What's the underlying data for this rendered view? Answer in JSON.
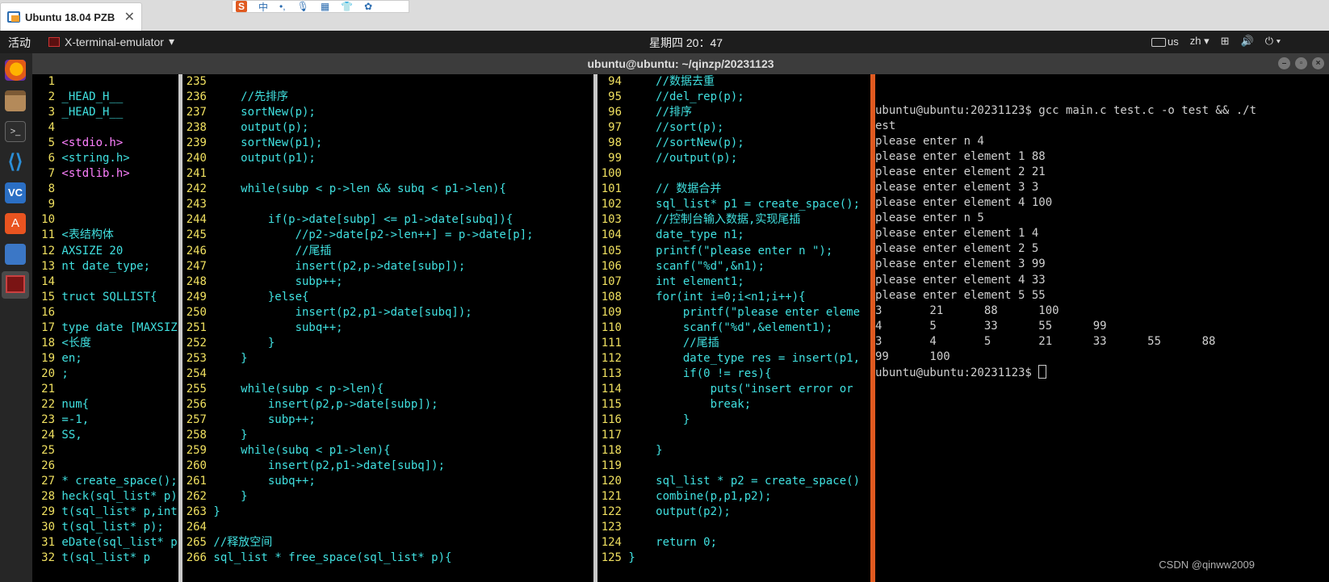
{
  "host": {
    "tab_title": "Ubuntu 18.04 PZB",
    "tab_close": "✕",
    "ime_s": "S",
    "ime_items": [
      "中",
      "•,",
      "🎙",
      "▦",
      "👕",
      "✿"
    ]
  },
  "panel": {
    "activities": "活动",
    "app_menu": "X-terminal-emulator",
    "clock": "星期四 20：47",
    "kbd": "us",
    "lang": "zh",
    "tray_icons": [
      "network-icon",
      "volume-icon",
      "power-icon"
    ]
  },
  "window": {
    "title": "ubuntu@ubuntu: ~/qinzp/20231123"
  },
  "pane1": {
    "rows": [
      {
        "n": "1",
        "t": ""
      },
      {
        "n": "2",
        "t": "_HEAD_H__"
      },
      {
        "n": "3",
        "t": "_HEAD_H__"
      },
      {
        "n": "4",
        "t": ""
      },
      {
        "n": "5",
        "t": "<stdio.h>"
      },
      {
        "n": "6",
        "t": "<string.h>"
      },
      {
        "n": "7",
        "t": "<stdlib.h>"
      },
      {
        "n": "8",
        "t": ""
      },
      {
        "n": "9",
        "t": ""
      },
      {
        "n": "10",
        "t": ""
      },
      {
        "n": "11",
        "t": "<表结构体"
      },
      {
        "n": "12",
        "t": "AXSIZE 20"
      },
      {
        "n": "13",
        "t": "nt date_type;"
      },
      {
        "n": "14",
        "t": ""
      },
      {
        "n": "15",
        "t": "truct SQLLIST{"
      },
      {
        "n": "16",
        "t": ""
      },
      {
        "n": "17",
        "t": "type date [MAXSIZ"
      },
      {
        "n": "18",
        "t": "<长度"
      },
      {
        "n": "19",
        "t": "en;"
      },
      {
        "n": "20",
        "t": ";"
      },
      {
        "n": "21",
        "t": ""
      },
      {
        "n": "22",
        "t": "num{"
      },
      {
        "n": "23",
        "t": "=-1,"
      },
      {
        "n": "24",
        "t": "SS,"
      },
      {
        "n": "25",
        "t": ""
      },
      {
        "n": "26",
        "t": ""
      },
      {
        "n": "27",
        "t": "* create_space();"
      },
      {
        "n": "28",
        "t": "heck(sql_list* p)"
      },
      {
        "n": "29",
        "t": "t(sql_list* p,int"
      },
      {
        "n": "30",
        "t": "t(sql_list* p);"
      },
      {
        "n": "31",
        "t": "eDate(sql_list* p"
      },
      {
        "n": "32",
        "t": "t(sql_list* p"
      }
    ]
  },
  "pane2": {
    "rows": [
      {
        "n": "235",
        "t": ""
      },
      {
        "n": "236",
        "t": "    //先排序"
      },
      {
        "n": "237",
        "t": "    sortNew(p);"
      },
      {
        "n": "238",
        "t": "    output(p);"
      },
      {
        "n": "239",
        "t": "    sortNew(p1);"
      },
      {
        "n": "240",
        "t": "    output(p1);"
      },
      {
        "n": "241",
        "t": ""
      },
      {
        "n": "242",
        "t": "    while(subp < p->len && subq < p1->len){"
      },
      {
        "n": "243",
        "t": ""
      },
      {
        "n": "244",
        "t": "        if(p->date[subp] <= p1->date[subq]){"
      },
      {
        "n": "245",
        "t": "            //p2->date[p2->len++] = p->date[p];"
      },
      {
        "n": "246",
        "t": "            //尾插"
      },
      {
        "n": "247",
        "t": "            insert(p2,p->date[subp]);"
      },
      {
        "n": "248",
        "t": "            subp++;"
      },
      {
        "n": "249",
        "t": "        }else{"
      },
      {
        "n": "250",
        "t": "            insert(p2,p1->date[subq]);"
      },
      {
        "n": "251",
        "t": "            subq++;"
      },
      {
        "n": "252",
        "t": "        }"
      },
      {
        "n": "253",
        "t": "    }"
      },
      {
        "n": "254",
        "t": ""
      },
      {
        "n": "255",
        "t": "    while(subp < p->len){"
      },
      {
        "n": "256",
        "t": "        insert(p2,p->date[subp]);"
      },
      {
        "n": "257",
        "t": "        subp++;"
      },
      {
        "n": "258",
        "t": "    }"
      },
      {
        "n": "259",
        "t": "    while(subq < p1->len){"
      },
      {
        "n": "260",
        "t": "        insert(p2,p1->date[subq]);"
      },
      {
        "n": "261",
        "t": "        subq++;"
      },
      {
        "n": "262",
        "t": "    }"
      },
      {
        "n": "263",
        "t": "}"
      },
      {
        "n": "264",
        "t": ""
      },
      {
        "n": "265",
        "t": "//释放空间"
      },
      {
        "n": "266",
        "t": "sql_list * free_space(sql_list* p){"
      }
    ]
  },
  "pane3": {
    "rows": [
      {
        "n": "94",
        "t": "    //数据去重"
      },
      {
        "n": "95",
        "t": "    //del_rep(p);"
      },
      {
        "n": "96",
        "t": "    //排序"
      },
      {
        "n": "97",
        "t": "    //sort(p);"
      },
      {
        "n": "98",
        "t": "    //sortNew(p);"
      },
      {
        "n": "99",
        "t": "    //output(p);"
      },
      {
        "n": "100",
        "t": ""
      },
      {
        "n": "101",
        "t": "    // 数据合并"
      },
      {
        "n": "102",
        "t": "    sql_list* p1 = create_space();"
      },
      {
        "n": "103",
        "t": "    //控制台输入数据,实现尾插"
      },
      {
        "n": "104",
        "t": "    date_type n1;"
      },
      {
        "n": "105",
        "t": "    printf(\"please enter n \");"
      },
      {
        "n": "106",
        "t": "    scanf(\"%d\",&n1);"
      },
      {
        "n": "107",
        "t": "    int element1;"
      },
      {
        "n": "108",
        "t": "    for(int i=0;i<n1;i++){"
      },
      {
        "n": "109",
        "t": "        printf(\"please enter eleme"
      },
      {
        "n": "110",
        "t": "        scanf(\"%d\",&element1);"
      },
      {
        "n": "111",
        "t": "        //尾插"
      },
      {
        "n": "112",
        "t": "        date_type res = insert(p1,"
      },
      {
        "n": "113",
        "t": "        if(0 != res){"
      },
      {
        "n": "114",
        "t": "            puts(\"insert error or"
      },
      {
        "n": "115",
        "t": "            break;"
      },
      {
        "n": "116",
        "t": "        }"
      },
      {
        "n": "117",
        "t": ""
      },
      {
        "n": "118",
        "t": "    }"
      },
      {
        "n": "119",
        "t": ""
      },
      {
        "n": "120",
        "t": "    sql_list * p2 = create_space()"
      },
      {
        "n": "121",
        "t": "    combine(p,p1,p2);"
      },
      {
        "n": "122",
        "t": "    output(p2);"
      },
      {
        "n": "123",
        "t": ""
      },
      {
        "n": "124",
        "t": "    return 0;"
      },
      {
        "n": "125",
        "t": "}"
      }
    ]
  },
  "terminal": {
    "lines": [
      "ubuntu@ubuntu:20231123$ gcc main.c test.c -o test && ./t",
      "est",
      "please enter n 4",
      "please enter element 1 88",
      "please enter element 2 21",
      "please enter element 3 3",
      "please enter element 4 100",
      "please enter n 5",
      "please enter element 1 4",
      "please enter element 2 5",
      "please enter element 3 99",
      "please enter element 4 33",
      "please enter element 5 55",
      "3       21      88      100",
      "4       5       33      55      99",
      "3       4       5       21      33      55      88",
      "99      100"
    ],
    "prompt": "ubuntu@ubuntu:20231123$ "
  },
  "watermark": "CSDN @qinww2009",
  "colors": {
    "line_number": "#f0e060",
    "code": "#40e0e0",
    "string": "#ff80ff",
    "keyword": "#f0e060",
    "split_active": "#e05a20"
  }
}
